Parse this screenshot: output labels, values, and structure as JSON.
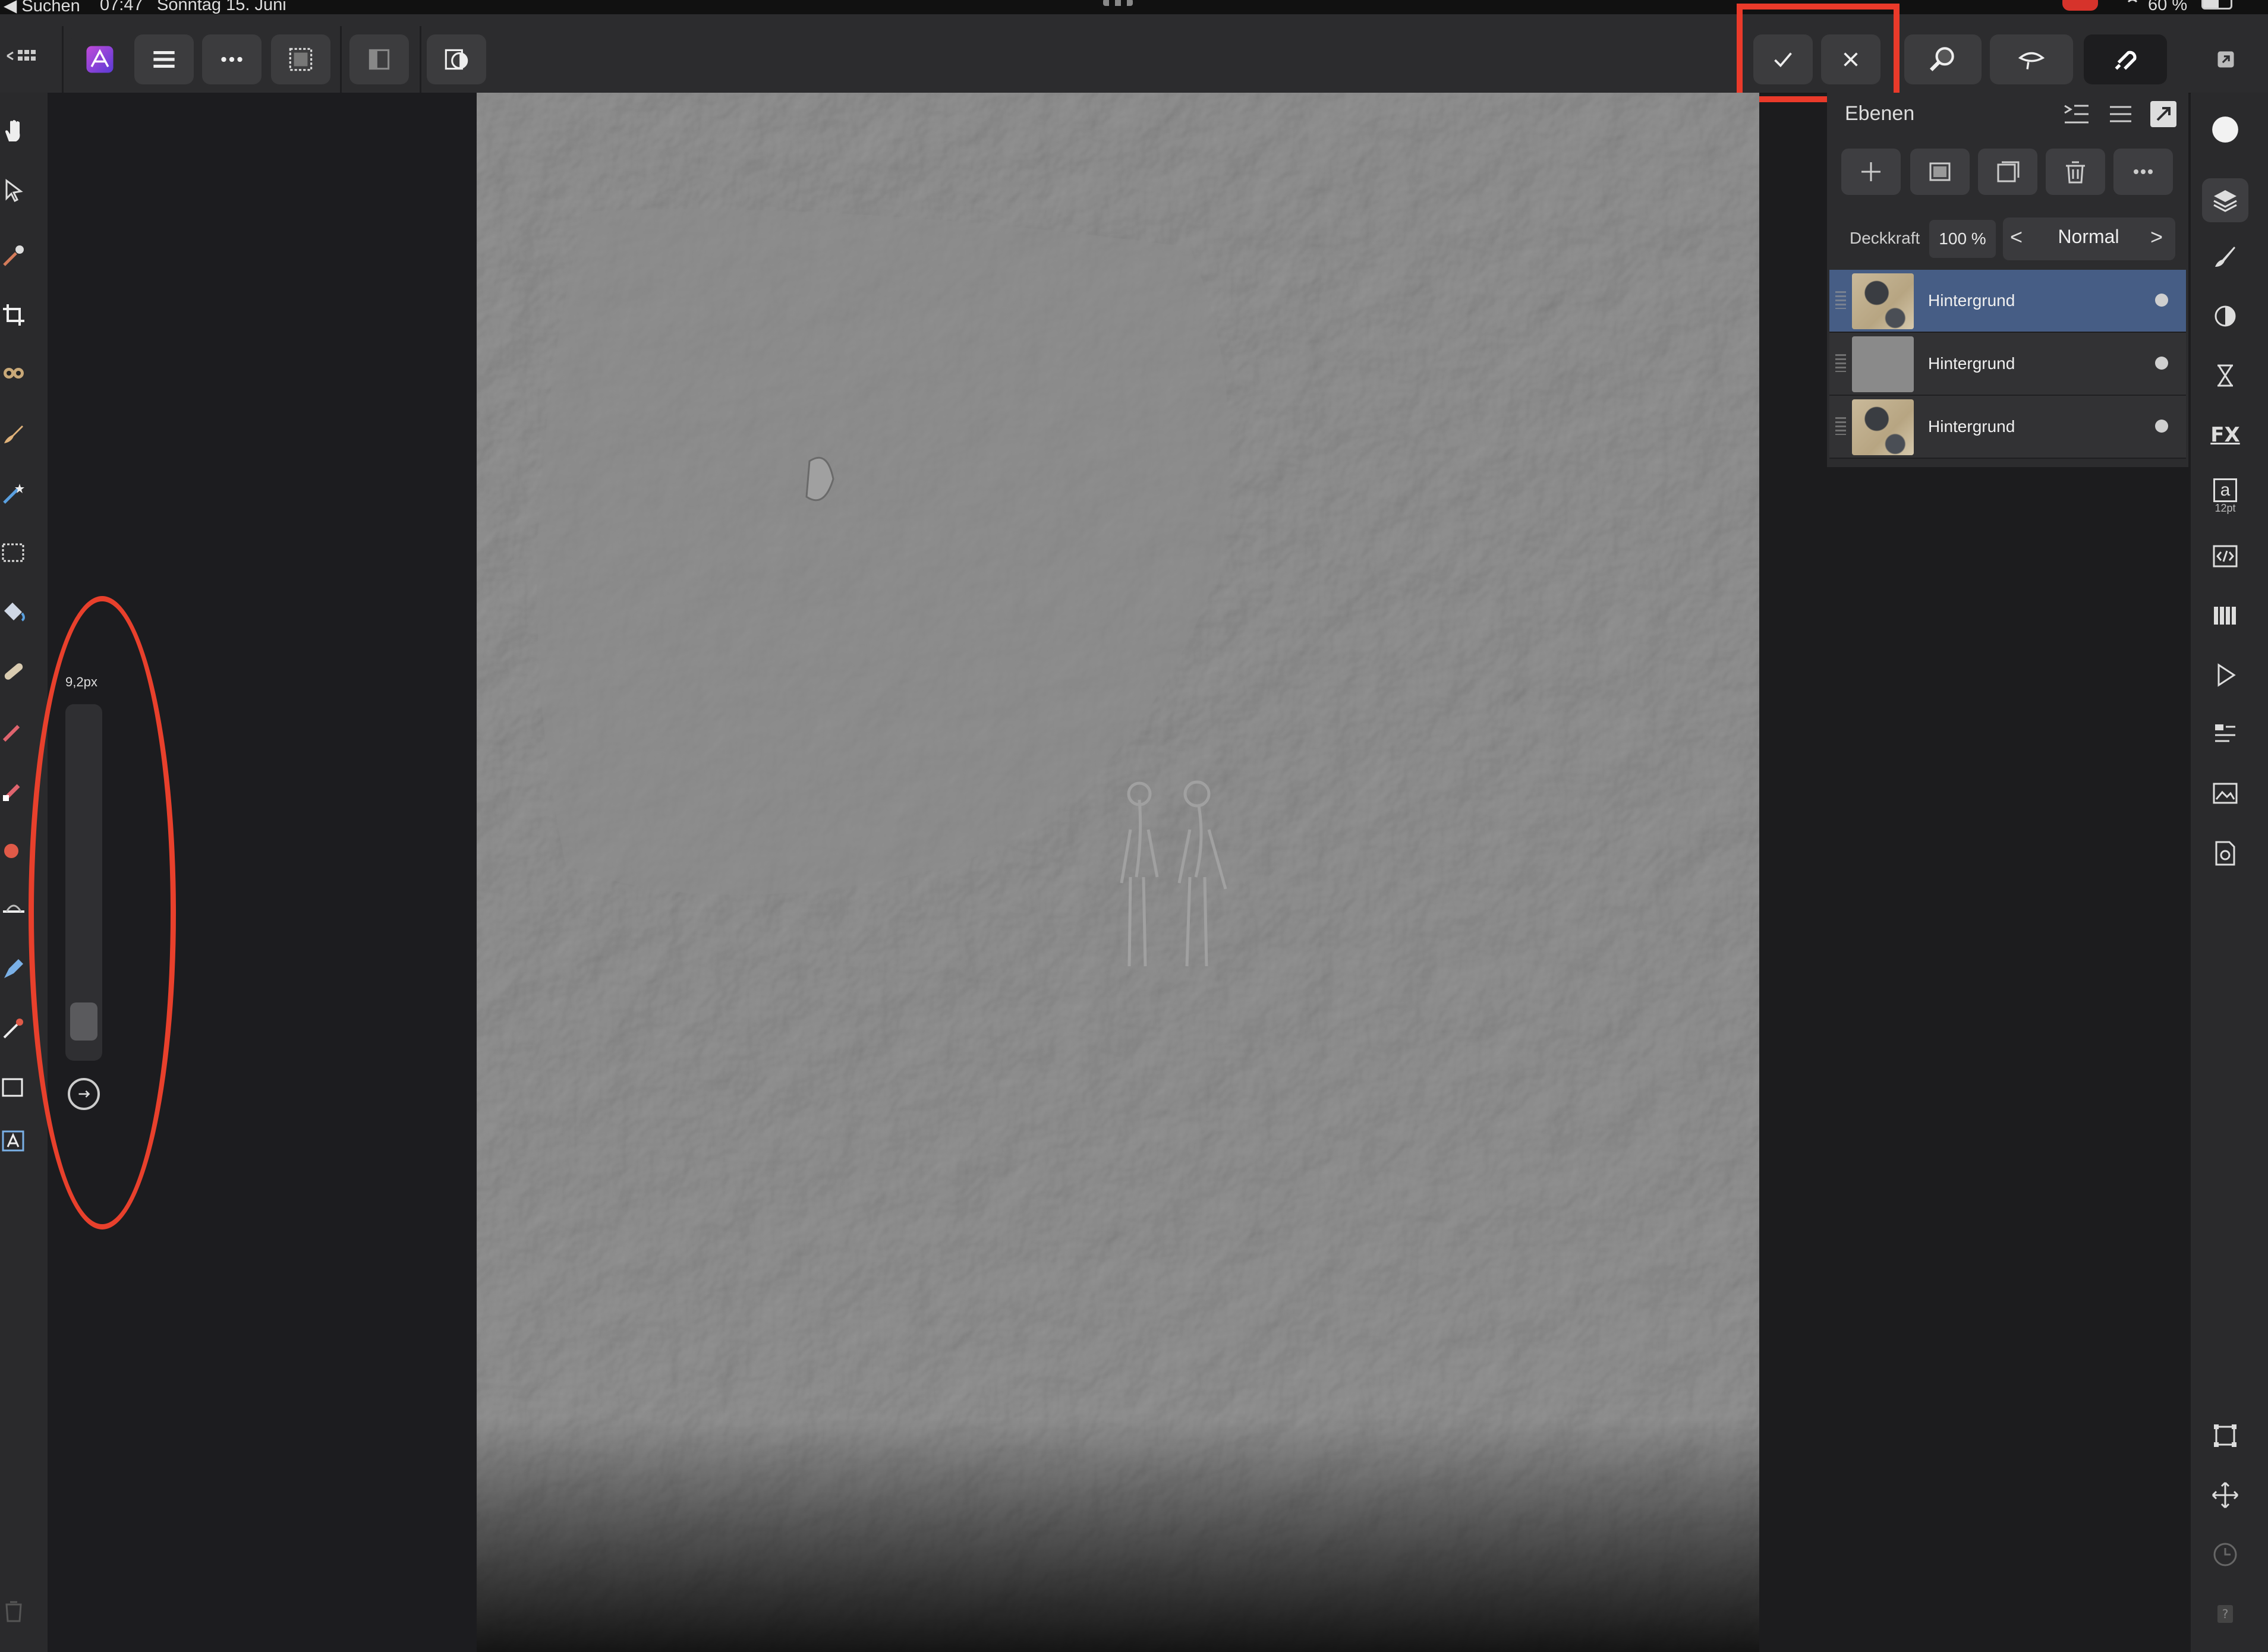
{
  "status_bar": {
    "back_label": "◀ Suchen",
    "time": "07:47",
    "date": "Sonntag 15. Juni",
    "battery": "60 %"
  },
  "toolbar": {
    "persona_name": "Photo Persona",
    "commit_icon": "checkmark-icon",
    "cancel_icon": "close-icon"
  },
  "brush_size": {
    "label": "9,2px",
    "value_fraction": 0.05
  },
  "layers_panel": {
    "title": "Ebenen",
    "opacity_label": "Deckkraft",
    "opacity_value": "100 %",
    "blend_mode": "Normal",
    "layers": [
      {
        "name": "Hintergrund",
        "thumb": "photo",
        "selected": true
      },
      {
        "name": "Hintergrund",
        "thumb": "gray",
        "selected": false
      },
      {
        "name": "Hintergrund",
        "thumb": "photo",
        "selected": false
      }
    ]
  },
  "right_studio": {
    "font_size_label": "12pt",
    "fx_label": "FX",
    "text_glyph": "a"
  },
  "colors": {
    "accent": "#465d85",
    "highlight": "#ea3a2a",
    "canvas": "#878787"
  }
}
